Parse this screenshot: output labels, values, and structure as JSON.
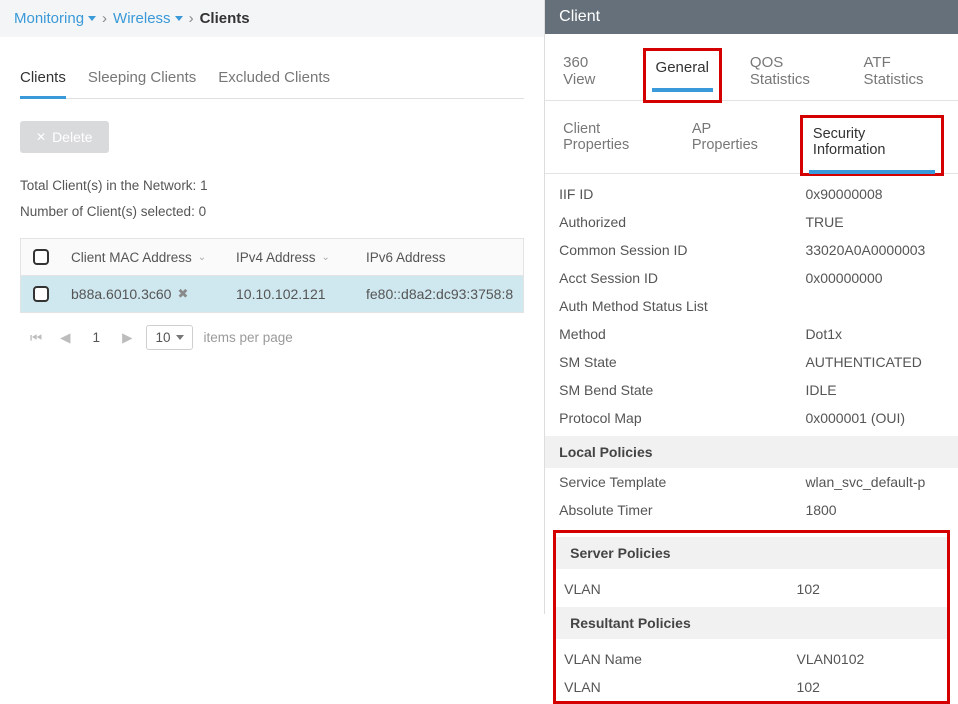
{
  "breadcrumbs": {
    "monitoring": "Monitoring",
    "wireless": "Wireless",
    "clients": "Clients"
  },
  "left_tabs": {
    "clients": "Clients",
    "sleeping": "Sleeping Clients",
    "excluded": "Excluded Clients"
  },
  "delete_label": "Delete",
  "counts": {
    "total_label": "Total Client(s) in the Network:",
    "total_value": "1",
    "selected_label": "Number of Client(s) selected:",
    "selected_value": "0"
  },
  "table": {
    "headers": {
      "mac": "Client MAC Address",
      "ipv4": "IPv4 Address",
      "ipv6": "IPv6 Address"
    },
    "rows": [
      {
        "mac": "b88a.6010.3c60",
        "ipv4": "10.10.102.121",
        "ipv6": "fe80::d8a2:dc93:3758:8"
      }
    ]
  },
  "pager": {
    "page": "1",
    "size": "10",
    "per_page": "items per page"
  },
  "panel": {
    "title": "Client",
    "primary_tabs": {
      "view360": "360 View",
      "general": "General",
      "qos": "QOS Statistics",
      "atf": "ATF Statistics"
    },
    "secondary_tabs": {
      "client_props": "Client Properties",
      "ap_props": "AP Properties",
      "security": "Security Information"
    },
    "details": [
      {
        "k": "IIF ID",
        "v": "0x90000008"
      },
      {
        "k": "Authorized",
        "v": "TRUE"
      },
      {
        "k": "Common Session ID",
        "v": "33020A0A0000003"
      },
      {
        "k": "Acct Session ID",
        "v": "0x00000000"
      },
      {
        "k": "Auth Method Status List",
        "v": ""
      },
      {
        "k": "Method",
        "v": "Dot1x"
      },
      {
        "k": "SM State",
        "v": "AUTHENTICATED"
      },
      {
        "k": "SM Bend State",
        "v": "IDLE"
      },
      {
        "k": "Protocol Map",
        "v": "0x000001 (OUI)"
      }
    ],
    "local_policies_label": "Local Policies",
    "local_policies": [
      {
        "k": "Service Template",
        "v": "wlan_svc_default-p"
      },
      {
        "k": "Absolute Timer",
        "v": "1800"
      }
    ],
    "server_policies_label": "Server Policies",
    "server_policies": [
      {
        "k": "VLAN",
        "v": "102"
      }
    ],
    "resultant_policies_label": "Resultant Policies",
    "resultant_policies": [
      {
        "k": "VLAN Name",
        "v": "VLAN0102"
      },
      {
        "k": "VLAN",
        "v": "102"
      }
    ]
  }
}
